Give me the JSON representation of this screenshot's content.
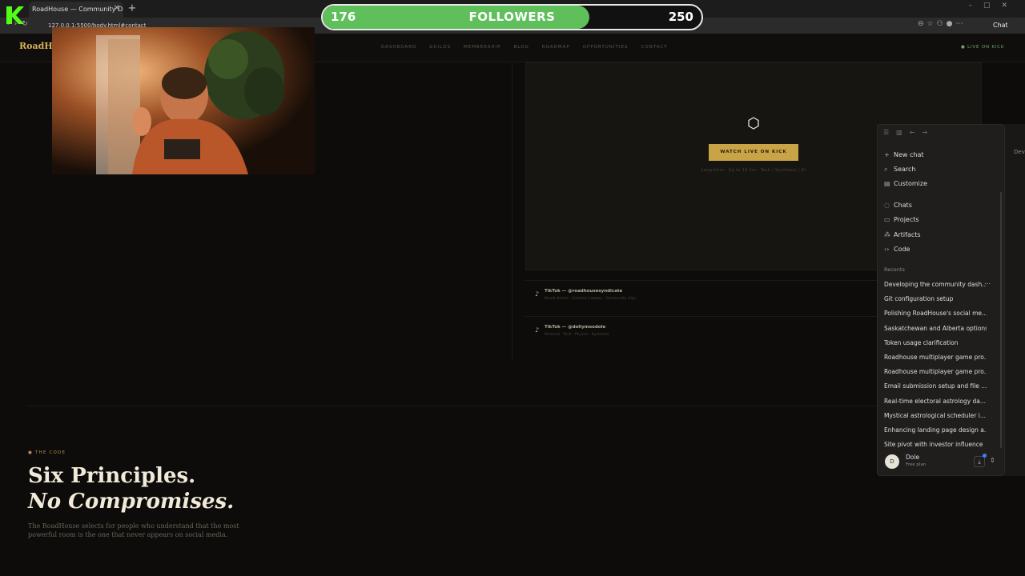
{
  "browser": {
    "tab_title": "RoadHouse — Community Dashb...",
    "url": "127.0.0.1:5500/body.html#contact",
    "chat_label": "Chat"
  },
  "overlay": {
    "followers_current": "176",
    "followers_label": "FOLLOWERS",
    "followers_goal": "250",
    "progress_fraction": 0.704
  },
  "site": {
    "brand": "RoadHou",
    "nav": [
      "DASHBOARD",
      "GUILDS",
      "MEMBERSHIP",
      "BLOG",
      "ROADMAP",
      "OPPORTUNITIES",
      "CONTACT"
    ],
    "live": "● LIVE ON KICK",
    "watch_button": "WATCH LIVE ON KICK",
    "watch_sub": "Long-form · Up to 12 hrs · Tech / Synthesis / AI",
    "tiktok": [
      {
        "title": "TikTok — @roadhousesyndicate",
        "sub": "Brand stories · Coconut Cowboy · Community clips"
      },
      {
        "title": "TikTok — @dollymoodole",
        "sub": "Personal · Tech · Physics · Synthesis"
      }
    ],
    "code_tag": "● THE CODE",
    "heading_line1": "Six Principles.",
    "heading_line2": "No Compromises.",
    "description": "The RoadHouse selects for people who understand that the most powerful room is the one that never appears on social media."
  },
  "sidebar": {
    "menu": [
      {
        "icon": "plus-icon",
        "glyph": "+",
        "label": "New chat"
      },
      {
        "icon": "search-icon",
        "glyph": "⌕",
        "label": "Search"
      },
      {
        "icon": "customize-icon",
        "glyph": "▤",
        "label": "Customize"
      }
    ],
    "menu2": [
      {
        "icon": "chats-icon",
        "glyph": "◌",
        "label": "Chats"
      },
      {
        "icon": "projects-icon",
        "glyph": "▭",
        "label": "Projects"
      },
      {
        "icon": "artifacts-icon",
        "glyph": "⁂",
        "label": "Artifacts"
      },
      {
        "icon": "code-icon",
        "glyph": "‹›",
        "label": "Code"
      }
    ],
    "recents_label": "Recents",
    "recents": [
      "Developing the community dash...",
      "Git configuration setup",
      "Polishing RoadHouse's social me...",
      "Saskatchewan and Alberta options",
      "Token usage clarification",
      "Roadhouse multiplayer game pro...",
      "Roadhouse multiplayer game pro...",
      "Email submission setup and file ...",
      "Real-time electoral astrology da...",
      "Mystical astrological scheduler i...",
      "Enhancing landing page design a...",
      "Site pivot with investor influence"
    ],
    "user_initial": "D",
    "user_name": "Dole",
    "user_plan": "Free plan",
    "right_peek": "Dev"
  },
  "colors": {
    "accent": "#c9a446",
    "progress": "#5fbf5a",
    "background": "#0d0c0b"
  }
}
